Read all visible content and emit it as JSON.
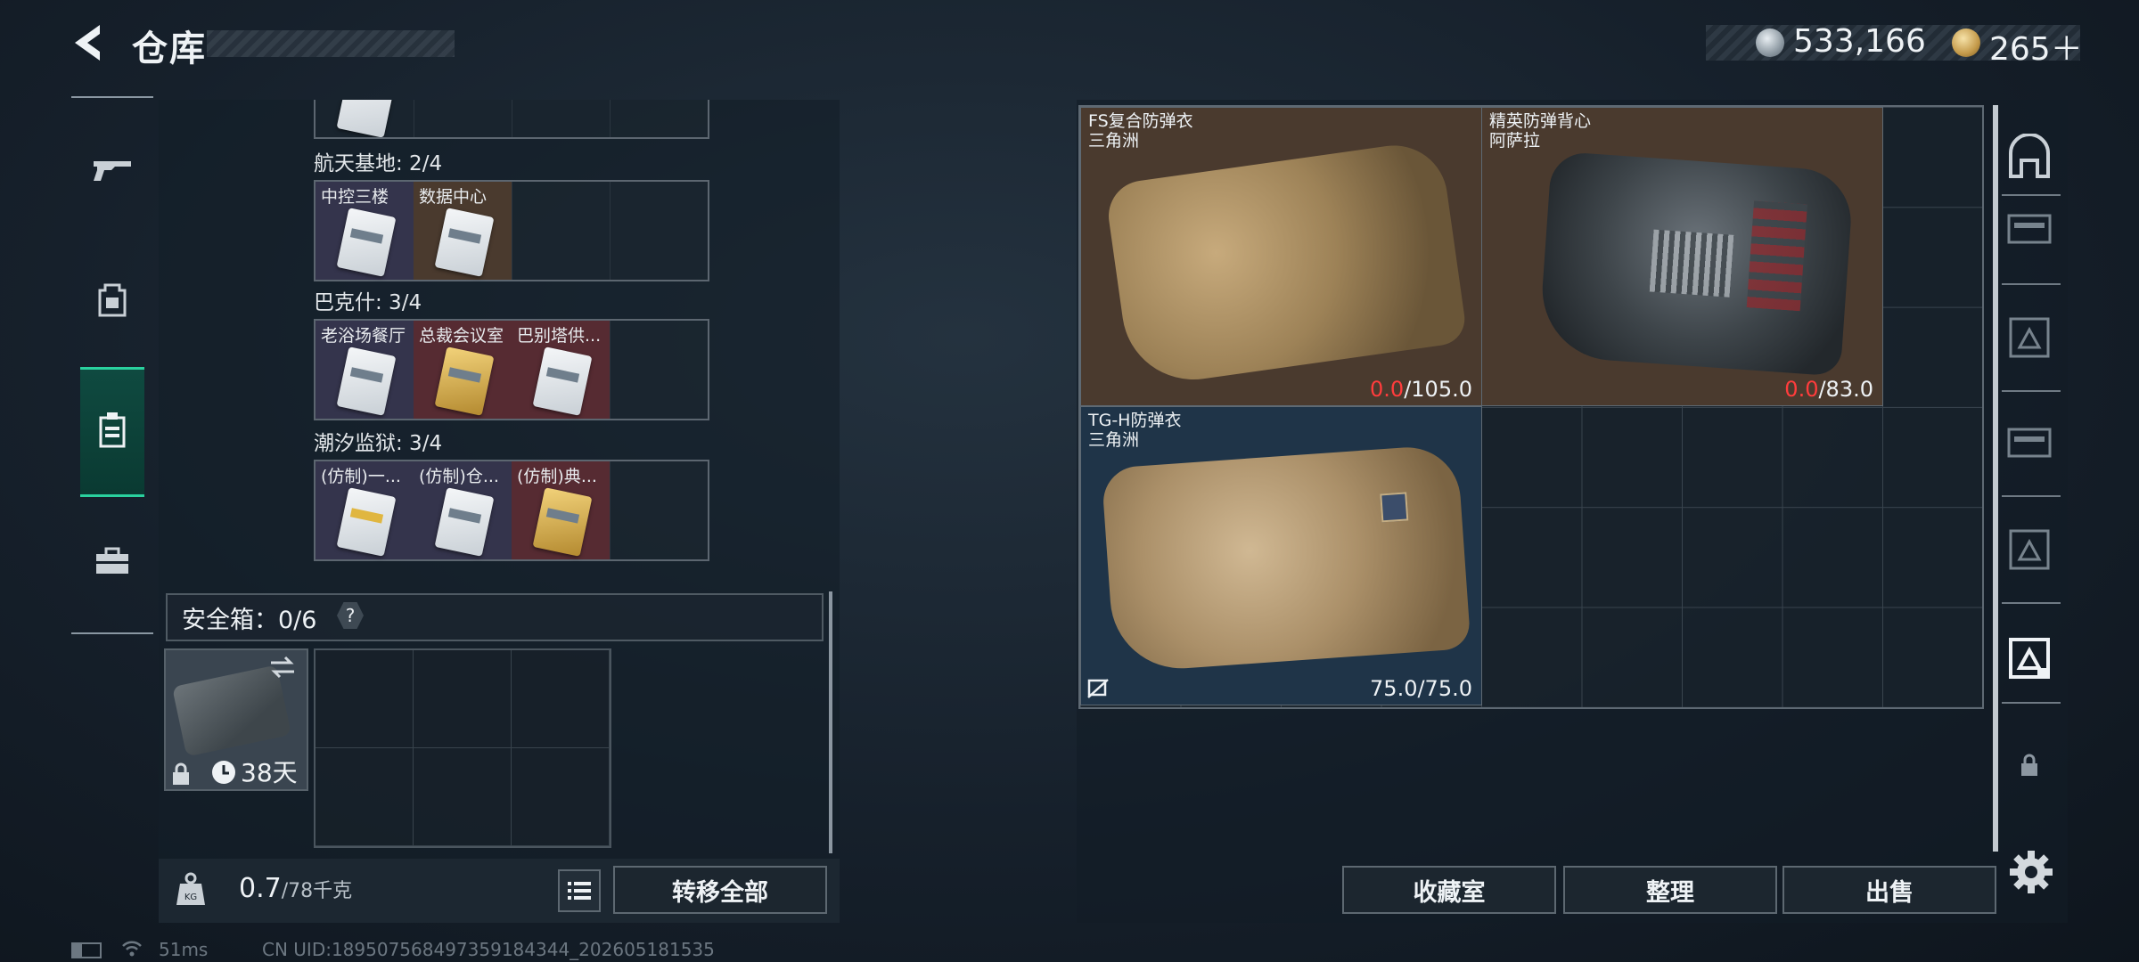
{
  "header": {
    "title": "仓库"
  },
  "currency": {
    "silver": "533,166",
    "gold": "265＋",
    "tiny_text": "???? · ??"
  },
  "left_nav": {
    "items": [
      {
        "name": "gun",
        "icon": "gun-icon"
      },
      {
        "name": "backpack",
        "icon": "backpack-icon"
      },
      {
        "name": "keycard-case",
        "icon": "keycard-case-icon",
        "active": true
      },
      {
        "name": "toolbox",
        "icon": "toolbox-icon"
      }
    ]
  },
  "key_sections": [
    {
      "label": "航天基地: 2/4",
      "slots": [
        {
          "name": "中控三楼",
          "bg": "purple"
        },
        {
          "name": "数据中心",
          "bg": "brown"
        },
        {
          "name": "",
          "bg": "empty"
        },
        {
          "name": "",
          "bg": "empty"
        }
      ]
    },
    {
      "label": "巴克什: 3/4",
      "slots": [
        {
          "name": "老浴场餐厅",
          "bg": "purple"
        },
        {
          "name": "总裁会议室",
          "bg": "red",
          "gold": true
        },
        {
          "name": "巴别塔供...",
          "bg": "red"
        },
        {
          "name": "",
          "bg": "empty"
        }
      ]
    },
    {
      "label": "潮汐监狱: 3/4",
      "slots": [
        {
          "name": "(仿制)一...",
          "bg": "purple"
        },
        {
          "name": "(仿制)仓...",
          "bg": "purple"
        },
        {
          "name": "(仿制)典...",
          "bg": "red",
          "gold": true
        },
        {
          "name": "",
          "bg": "empty"
        }
      ]
    }
  ],
  "safe_box": {
    "label": "安全箱：0/6",
    "help": "?",
    "case_days": "38天"
  },
  "bottom_left": {
    "weight": "0.7",
    "weight_max": "/78千克",
    "transfer_all": "转移全部"
  },
  "inventory": {
    "items": [
      {
        "name": "FS复合防弹衣",
        "origin": "三角洲",
        "dur_current": "0.0",
        "dur_max": "/105.0",
        "bg": "#4a3a2e"
      },
      {
        "name": "精英防弹背心",
        "origin": "阿萨拉",
        "dur_current": "0.0",
        "dur_max": "/83.0",
        "bg": "#4a3a2e"
      },
      {
        "name": "TG-H防弹衣",
        "origin": "三角洲",
        "dur_full": "75.0/75.0",
        "bg": "#1f3448"
      }
    ]
  },
  "actions": {
    "collection": "收藏室",
    "organize": "整理",
    "sell": "出售"
  },
  "status": {
    "ping": "51ms",
    "uid": "CN UID:189507568497359184344_202605181535"
  }
}
